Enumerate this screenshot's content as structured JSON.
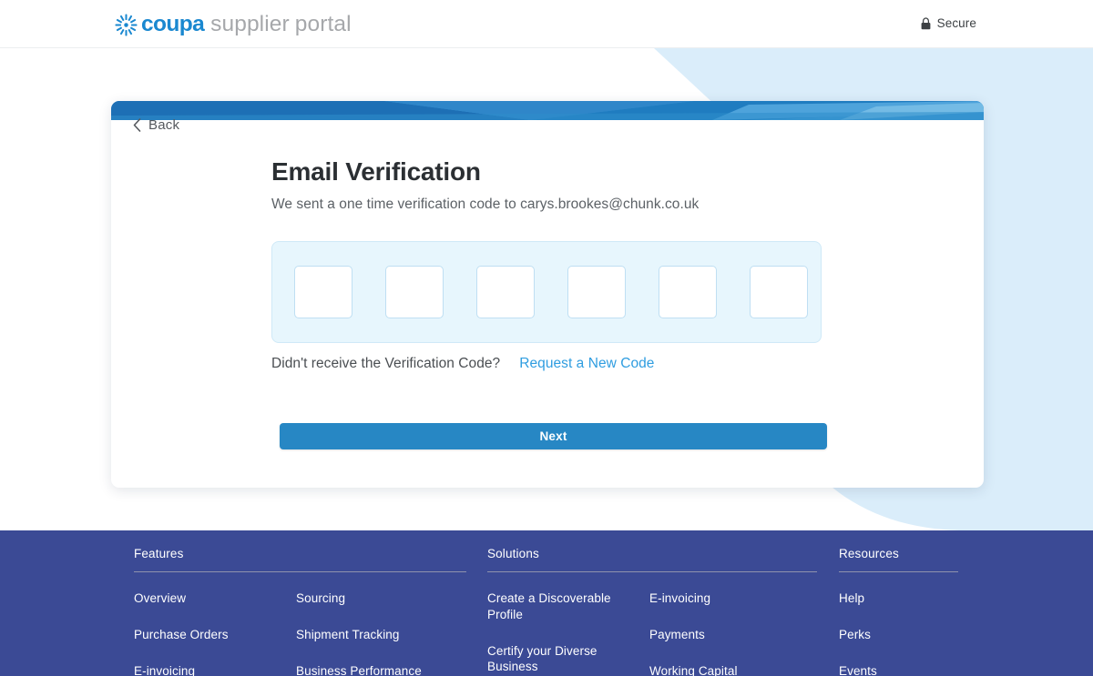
{
  "header": {
    "logo": {
      "icon": "coupa-starburst-icon",
      "brand": "coupa",
      "word1": "supplier",
      "word2": "portal"
    },
    "secure": {
      "icon": "lock-icon",
      "label": "Secure"
    }
  },
  "card": {
    "back": {
      "icon": "chevron-left-icon",
      "label": "Back"
    },
    "title": "Email Verification",
    "subtitle": "We sent a one time verification code to carys.brookes@chunk.co.uk",
    "otp": {
      "length": 6,
      "values": [
        "",
        "",
        "",
        "",
        "",
        ""
      ],
      "placeholder": ""
    },
    "resend": {
      "question": "Didn't receive the Verification Code?",
      "link": "Request a New Code"
    },
    "next_label": "Next"
  },
  "footer": {
    "columns": [
      {
        "heading": "Features",
        "lists": [
          [
            "Overview",
            "Purchase Orders",
            "E-invoicing"
          ],
          [
            "Sourcing",
            "Shipment Tracking",
            "Business Performance"
          ]
        ]
      },
      {
        "heading": "Solutions",
        "lists": [
          [
            "Create a Discoverable Profile",
            "Certify your Diverse Business"
          ],
          [
            "E-invoicing",
            "Payments",
            "Working Capital"
          ]
        ]
      },
      {
        "heading": "Resources",
        "lists": [
          [
            "Help",
            "Perks",
            "Events"
          ]
        ]
      }
    ]
  },
  "colors": {
    "brand_blue": "#1a88d0",
    "button_blue": "#2787c4",
    "link_blue": "#2f9de0",
    "footer_indigo": "#3b4a95",
    "otp_panel_bg": "#e7f6fd",
    "deco_blue": "#daedfa"
  }
}
